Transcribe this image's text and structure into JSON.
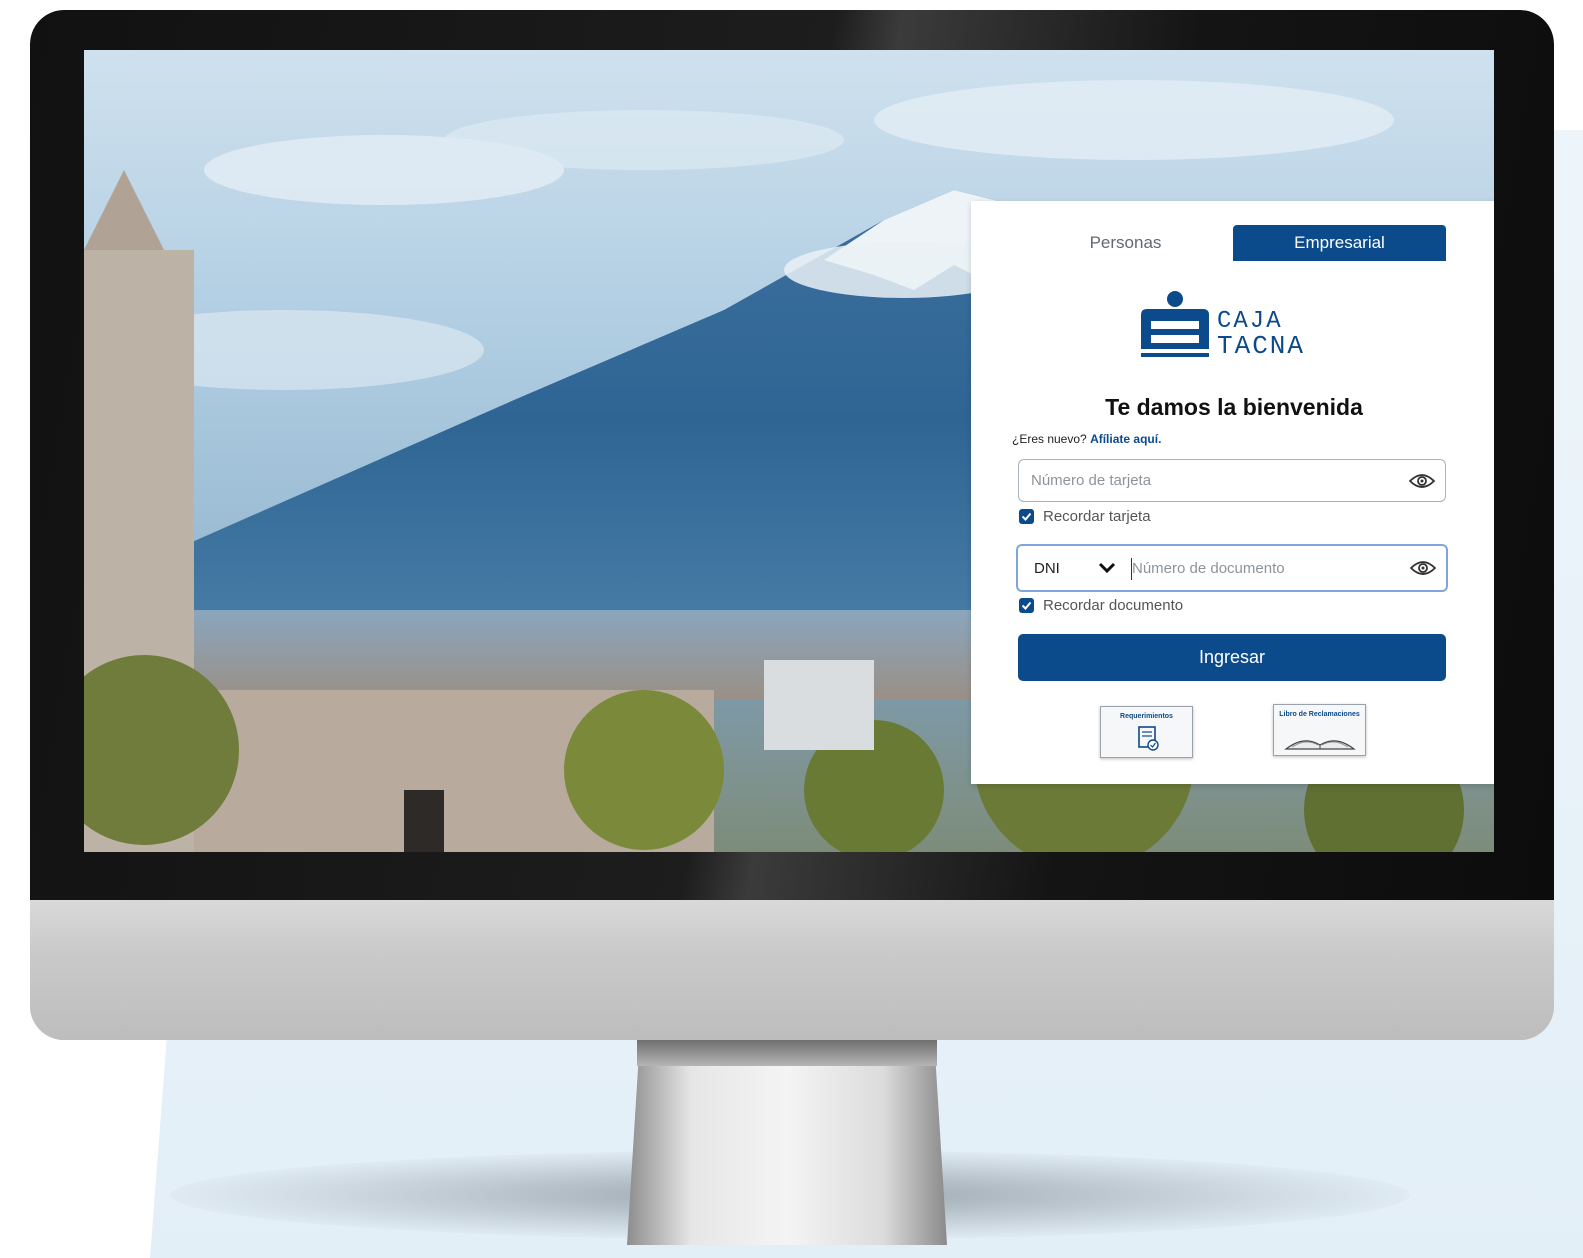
{
  "login": {
    "tabs": {
      "personas": "Personas",
      "empresarial": "Empresarial"
    },
    "logo": {
      "line1": "CAJA",
      "line2": "TACNA"
    },
    "welcome": "Te damos la bienvenida",
    "new_user_prefix": "¿Eres nuevo?",
    "new_user_link": "Afíliate aquí.",
    "card_field": {
      "placeholder": "Número de tarjeta",
      "value": ""
    },
    "remember_card": "Recordar tarjeta",
    "doc_type": "DNI",
    "doc_field": {
      "placeholder": "Número de documento",
      "value": ""
    },
    "remember_doc": "Recordar documento",
    "submit": "Ingresar",
    "links": {
      "requerimientos": "Requerimientos",
      "libro": "Libro de Reclamaciones"
    }
  },
  "colors": {
    "brand_blue": "#0b4a8b",
    "focus_border": "#7fa6d8"
  },
  "icons": [
    "eye-icon",
    "chevron-down-icon",
    "checkbox-checked-icon",
    "document-check-icon",
    "open-book-icon"
  ]
}
